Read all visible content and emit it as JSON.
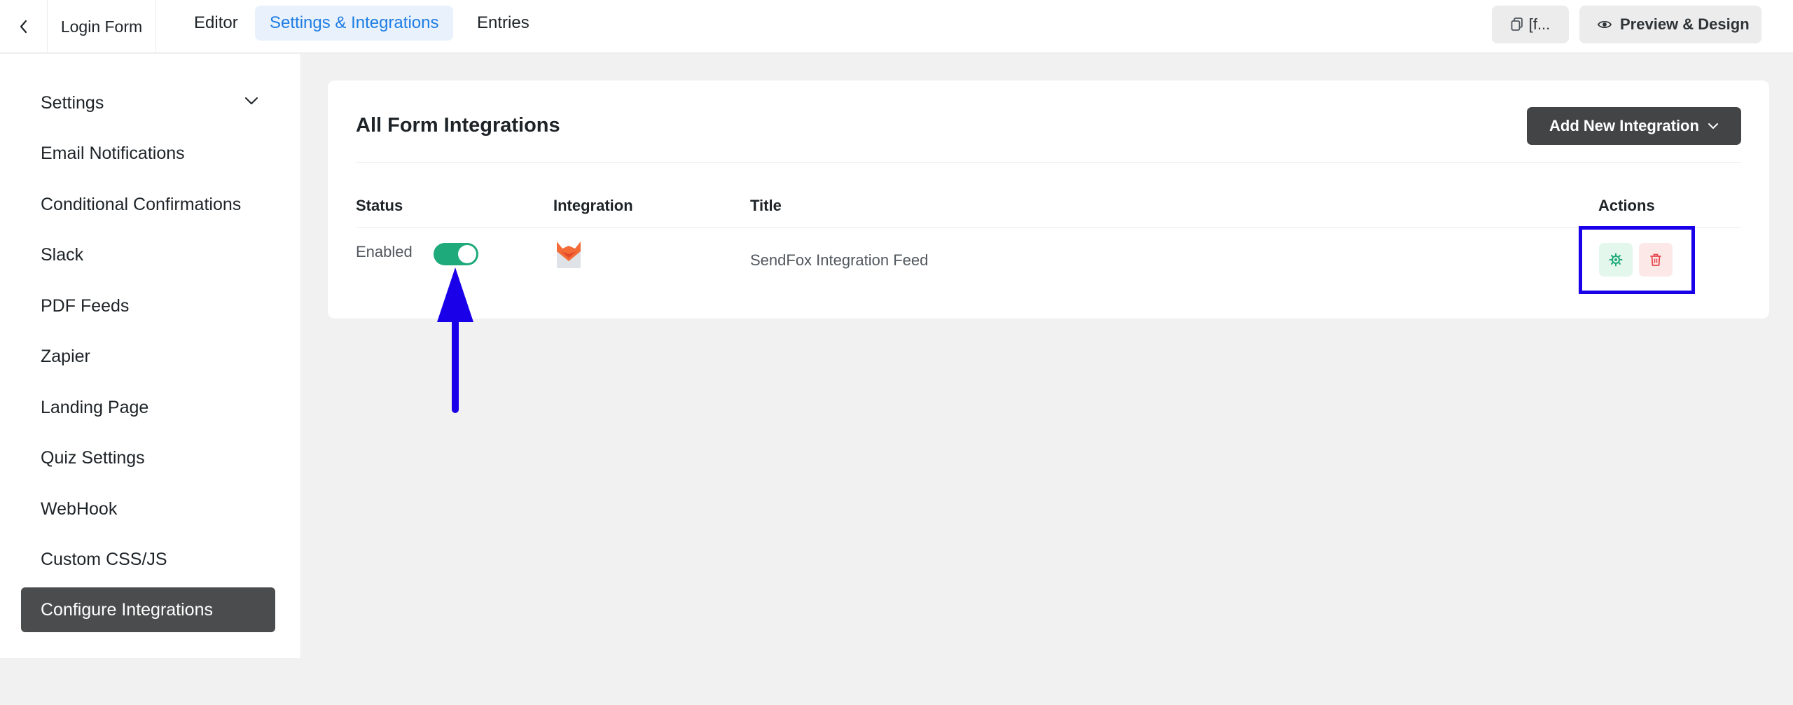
{
  "topbar": {
    "back_icon": "chevron-left-icon",
    "form_name": "Login Form",
    "tabs": [
      {
        "label": "Editor",
        "active": false
      },
      {
        "label": "Settings & Integrations",
        "active": true
      },
      {
        "label": "Entries",
        "active": false
      }
    ],
    "shortcode_button": {
      "label": "[f...",
      "icon": "copy-icon"
    },
    "preview_button": {
      "label": "Preview & Design",
      "icon": "eye-icon"
    }
  },
  "sidebar": {
    "items": [
      {
        "label": "Settings",
        "expandable": true,
        "active": false
      },
      {
        "label": "Email Notifications",
        "active": false
      },
      {
        "label": "Conditional Confirmations",
        "active": false
      },
      {
        "label": "Slack",
        "active": false
      },
      {
        "label": "PDF Feeds",
        "active": false
      },
      {
        "label": "Zapier",
        "active": false
      },
      {
        "label": "Landing Page",
        "active": false
      },
      {
        "label": "Quiz Settings",
        "active": false
      },
      {
        "label": "WebHook",
        "active": false
      },
      {
        "label": "Custom CSS/JS",
        "active": false
      },
      {
        "label": "Configure Integrations",
        "active": true
      }
    ]
  },
  "main": {
    "title": "All Form Integrations",
    "add_button": {
      "label": "Add New Integration",
      "icon": "chevron-down-icon"
    },
    "table": {
      "headers": {
        "status": "Status",
        "integration": "Integration",
        "title": "Title",
        "actions": "Actions"
      },
      "rows": [
        {
          "status": "Enabled",
          "enabled": true,
          "integration_icon": "sendfox-logo-icon",
          "title": "SendFox Integration Feed",
          "actions": [
            "gear-icon",
            "trash-icon"
          ]
        }
      ]
    }
  },
  "colors": {
    "accent_blue": "#1e7de3",
    "toggle_on": "#1eaa7a",
    "dark_button": "#434446",
    "annotation": "#1a00e8"
  }
}
